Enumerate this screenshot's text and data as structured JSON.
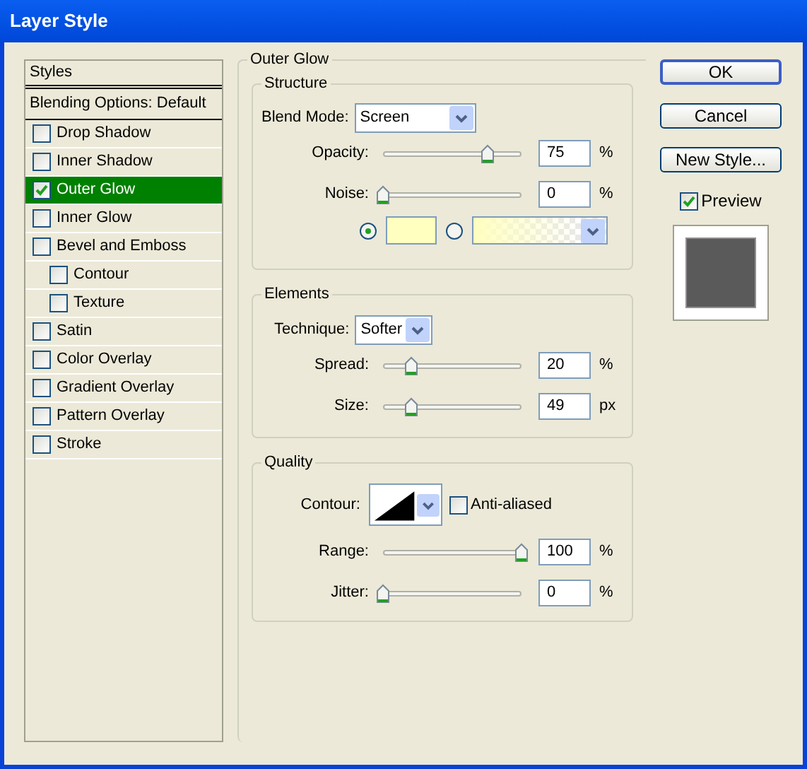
{
  "window": {
    "title": "Layer Style"
  },
  "styles_panel": {
    "header": "Styles",
    "blending_options": "Blending Options: Default",
    "items": [
      {
        "label": "Drop Shadow",
        "checked": false,
        "selected": false
      },
      {
        "label": "Inner Shadow",
        "checked": false,
        "selected": false
      },
      {
        "label": "Outer Glow",
        "checked": true,
        "selected": true
      },
      {
        "label": "Inner Glow",
        "checked": false,
        "selected": false
      },
      {
        "label": "Bevel and Emboss",
        "checked": false,
        "selected": false,
        "children": [
          {
            "label": "Contour",
            "checked": false,
            "selected": false
          },
          {
            "label": "Texture",
            "checked": false,
            "selected": false
          }
        ]
      },
      {
        "label": "Satin",
        "checked": false,
        "selected": false
      },
      {
        "label": "Color Overlay",
        "checked": false,
        "selected": false
      },
      {
        "label": "Gradient Overlay",
        "checked": false,
        "selected": false
      },
      {
        "label": "Pattern Overlay",
        "checked": false,
        "selected": false
      },
      {
        "label": "Stroke",
        "checked": false,
        "selected": false
      }
    ]
  },
  "outer_glow": {
    "title": "Outer Glow",
    "structure": {
      "title": "Structure",
      "blend_mode": {
        "label": "Blend Mode:",
        "value": "Screen"
      },
      "sliders": [
        {
          "label": "Opacity:",
          "level": 0.75,
          "value": "75",
          "unit": "%"
        },
        {
          "label": "Noise:",
          "level": 0,
          "value": "0",
          "unit": "%"
        }
      ],
      "fill_options": [
        {
          "kind": "color",
          "selected": true
        },
        {
          "kind": "gradient",
          "selected": false
        }
      ]
    },
    "elements": {
      "title": "Elements",
      "technique": {
        "label": "Technique:",
        "value": "Softer"
      },
      "sliders": [
        {
          "label": "Spread:",
          "level": 0.2,
          "value": "20",
          "unit": "%"
        },
        {
          "label": "Size:",
          "level": 0.2,
          "value": "49",
          "unit": "px"
        }
      ]
    },
    "quality": {
      "title": "Quality",
      "contour": {
        "label": "Contour:"
      },
      "anti_aliased": {
        "label": "Anti-aliased",
        "checked": false
      },
      "sliders": [
        {
          "label": "Range:",
          "level": 1,
          "value": "100",
          "unit": "%"
        },
        {
          "label": "Jitter:",
          "level": 0,
          "value": "0",
          "unit": "%"
        }
      ]
    }
  },
  "buttons": [
    {
      "label": "OK",
      "default": true
    },
    {
      "label": "Cancel",
      "default": false
    },
    {
      "label": "New Style...",
      "default": false
    }
  ],
  "preview": {
    "label": "Preview",
    "checked": true
  }
}
